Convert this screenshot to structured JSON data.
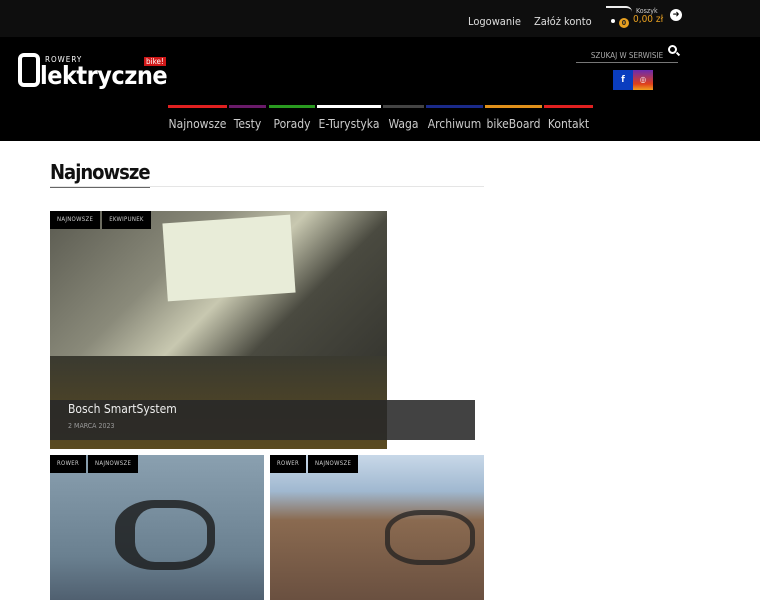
{
  "topbar": {
    "login": "Logowanie",
    "register": "Załóż konto",
    "cart_label": "Koszyk",
    "cart_count": "0",
    "cart_total": "0,00 zł"
  },
  "logo": {
    "small": "ROWERY",
    "main": "lektryczne",
    "badge": "bike!"
  },
  "search": {
    "placeholder": "SZUKAJ W SERWISIE"
  },
  "social": {
    "facebook": "f",
    "instagram": "◎"
  },
  "nav": [
    {
      "label": "Najnowsze",
      "color": "#e02020"
    },
    {
      "label": "Testy",
      "color": "#6a1b6a"
    },
    {
      "label": "Porady",
      "color": "#2a9a20"
    },
    {
      "label": "E-Turystyka",
      "color": "#ffffff"
    },
    {
      "label": "Waga",
      "color": "#444444"
    },
    {
      "label": "Archiwum",
      "color": "#1a2a8a"
    },
    {
      "label": "bikeBoard",
      "color": "#e0901a"
    },
    {
      "label": "Kontakt",
      "color": "#e02020"
    }
  ],
  "section_title": "Najnowsze",
  "featured": {
    "tags": [
      "NAJNOWSZE",
      "EKWIPUNEK"
    ],
    "title": "Bosch SmartSystem",
    "date": "2 MARCA 2023"
  },
  "cards": [
    {
      "tags": [
        "ROWER",
        "NAJNOWSZE"
      ]
    },
    {
      "tags": [
        "ROWER",
        "NAJNOWSZE"
      ]
    }
  ]
}
